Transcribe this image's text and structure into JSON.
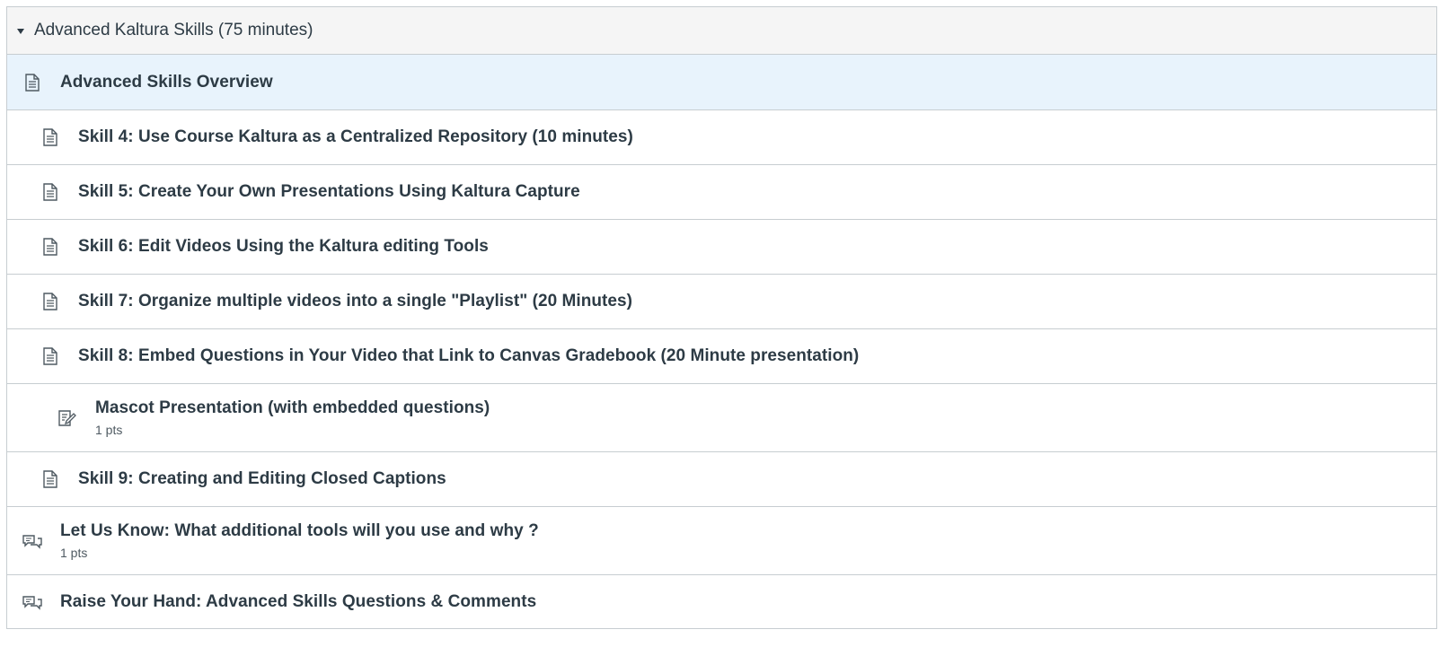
{
  "module": {
    "title": "Advanced Kaltura Skills (75 minutes)",
    "items": [
      {
        "title": "Advanced Skills Overview",
        "icon": "page-icon",
        "indent": 0,
        "active": true
      },
      {
        "title": "Skill 4: Use Course Kaltura as a Centralized Repository (10 minutes)",
        "icon": "page-icon",
        "indent": 1
      },
      {
        "title": "Skill 5: Create Your Own Presentations Using Kaltura Capture",
        "icon": "page-icon",
        "indent": 1
      },
      {
        "title": "Skill 6: Edit Videos Using the Kaltura editing Tools",
        "icon": "page-icon",
        "indent": 1
      },
      {
        "title": "Skill 7: Organize multiple videos into a single \"Playlist\" (20 Minutes)",
        "icon": "page-icon",
        "indent": 1
      },
      {
        "title": "Skill 8: Embed Questions in Your Video that Link to Canvas Gradebook (20 Minute presentation)",
        "icon": "page-icon",
        "indent": 1
      },
      {
        "title": "Mascot Presentation (with embedded questions)",
        "icon": "assignment-icon",
        "indent": 2,
        "points": "1 pts"
      },
      {
        "title": "Skill 9: Creating and Editing Closed Captions",
        "icon": "page-icon",
        "indent": 1
      },
      {
        "title": "Let Us Know: What additional tools will you use and why ?",
        "icon": "discussion-icon",
        "indent": 0,
        "points": "1 pts"
      },
      {
        "title": "Raise Your Hand: Advanced Skills Questions & Comments",
        "icon": "discussion-icon",
        "indent": 0
      }
    ]
  },
  "colors": {
    "text": "#2d3b45",
    "header_bg": "#f5f5f5",
    "active_bg": "#e8f3fc",
    "border": "#c7cdd1"
  }
}
